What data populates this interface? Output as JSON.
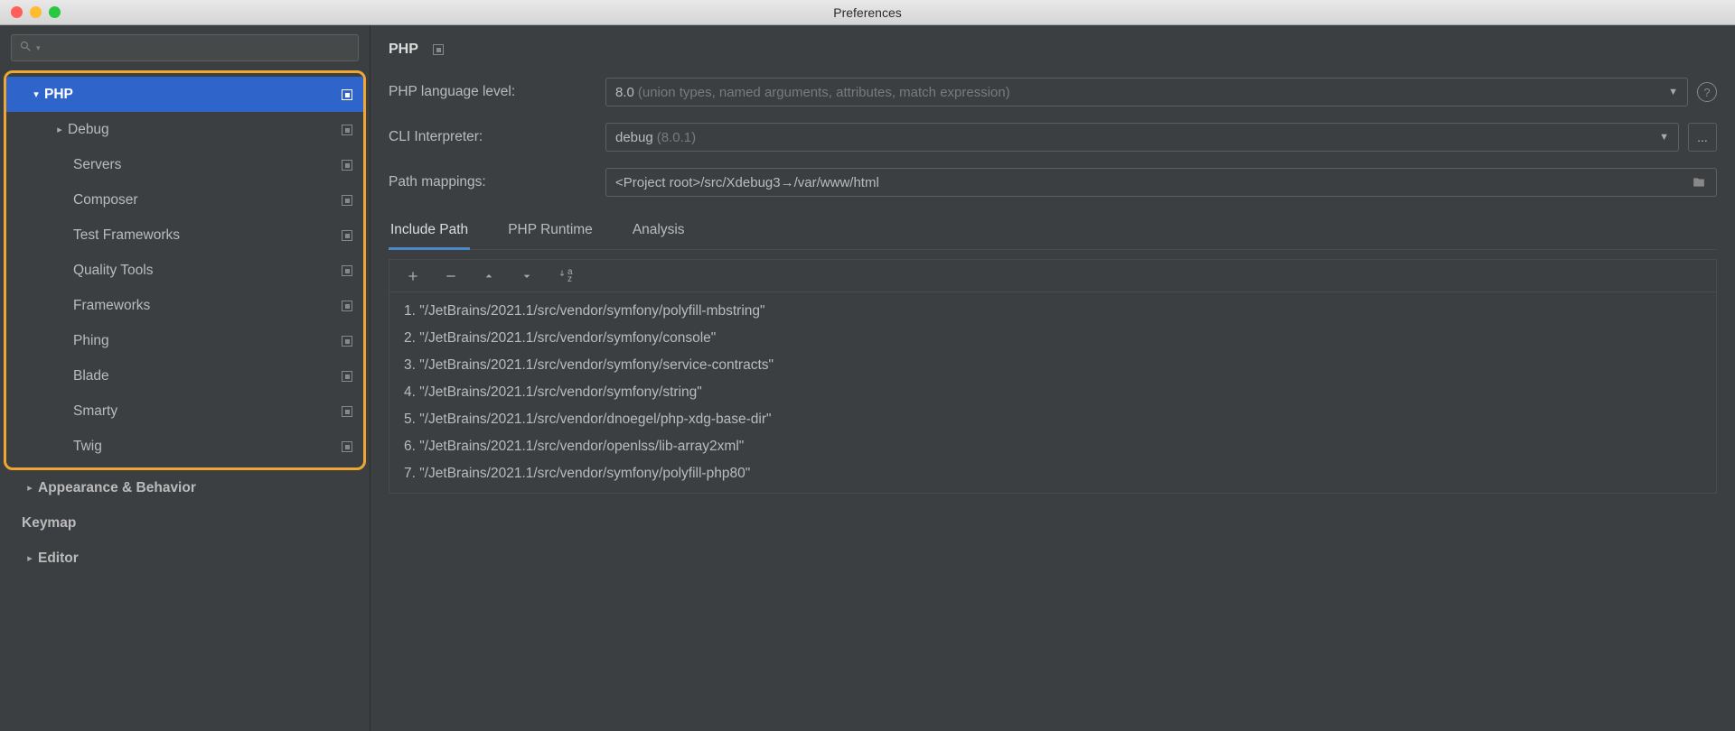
{
  "window": {
    "title": "Preferences"
  },
  "sidebar": {
    "items": [
      {
        "label": "PHP",
        "indent": 1,
        "arrow": "down",
        "selected": true,
        "bold": true,
        "proj": true
      },
      {
        "label": "Debug",
        "indent": 2,
        "arrow": "right",
        "selected": false,
        "bold": false,
        "proj": true
      },
      {
        "label": "Servers",
        "indent": 2,
        "arrow": "",
        "selected": false,
        "bold": false,
        "proj": true
      },
      {
        "label": "Composer",
        "indent": 2,
        "arrow": "",
        "selected": false,
        "bold": false,
        "proj": true
      },
      {
        "label": "Test Frameworks",
        "indent": 2,
        "arrow": "",
        "selected": false,
        "bold": false,
        "proj": true
      },
      {
        "label": "Quality Tools",
        "indent": 2,
        "arrow": "",
        "selected": false,
        "bold": false,
        "proj": true
      },
      {
        "label": "Frameworks",
        "indent": 2,
        "arrow": "",
        "selected": false,
        "bold": false,
        "proj": true
      },
      {
        "label": "Phing",
        "indent": 2,
        "arrow": "",
        "selected": false,
        "bold": false,
        "proj": true
      },
      {
        "label": "Blade",
        "indent": 2,
        "arrow": "",
        "selected": false,
        "bold": false,
        "proj": true
      },
      {
        "label": "Smarty",
        "indent": 2,
        "arrow": "",
        "selected": false,
        "bold": false,
        "proj": true
      },
      {
        "label": "Twig",
        "indent": 2,
        "arrow": "",
        "selected": false,
        "bold": false,
        "proj": true
      }
    ],
    "below": [
      {
        "label": "Appearance & Behavior",
        "indent": 1,
        "arrow": "right",
        "bold": true
      },
      {
        "label": "Keymap",
        "indent": 1,
        "arrow": "",
        "bold": true
      },
      {
        "label": "Editor",
        "indent": 1,
        "arrow": "right",
        "bold": true
      }
    ]
  },
  "page": {
    "title": "PHP",
    "form": {
      "lang_level_label": "PHP language level:",
      "lang_level_value": "8.0",
      "lang_level_hint": "(union types, named arguments, attributes, match expression)",
      "cli_label": "CLI Interpreter:",
      "cli_value": "debug",
      "cli_hint": "(8.0.1)",
      "cli_browse": "...",
      "paths_label": "Path mappings:",
      "paths_value": "<Project root>/src/Xdebug3→/var/www/html"
    },
    "tabs": [
      {
        "label": "Include Path",
        "active": true
      },
      {
        "label": "PHP Runtime",
        "active": false
      },
      {
        "label": "Analysis",
        "active": false
      }
    ],
    "include_paths": [
      "1. \"/JetBrains/2021.1/src/vendor/symfony/polyfill-mbstring\"",
      "2. \"/JetBrains/2021.1/src/vendor/symfony/console\"",
      "3. \"/JetBrains/2021.1/src/vendor/symfony/service-contracts\"",
      "4. \"/JetBrains/2021.1/src/vendor/symfony/string\"",
      "5. \"/JetBrains/2021.1/src/vendor/dnoegel/php-xdg-base-dir\"",
      "6. \"/JetBrains/2021.1/src/vendor/openlss/lib-array2xml\"",
      "7. \"/JetBrains/2021.1/src/vendor/symfony/polyfill-php80\""
    ]
  }
}
